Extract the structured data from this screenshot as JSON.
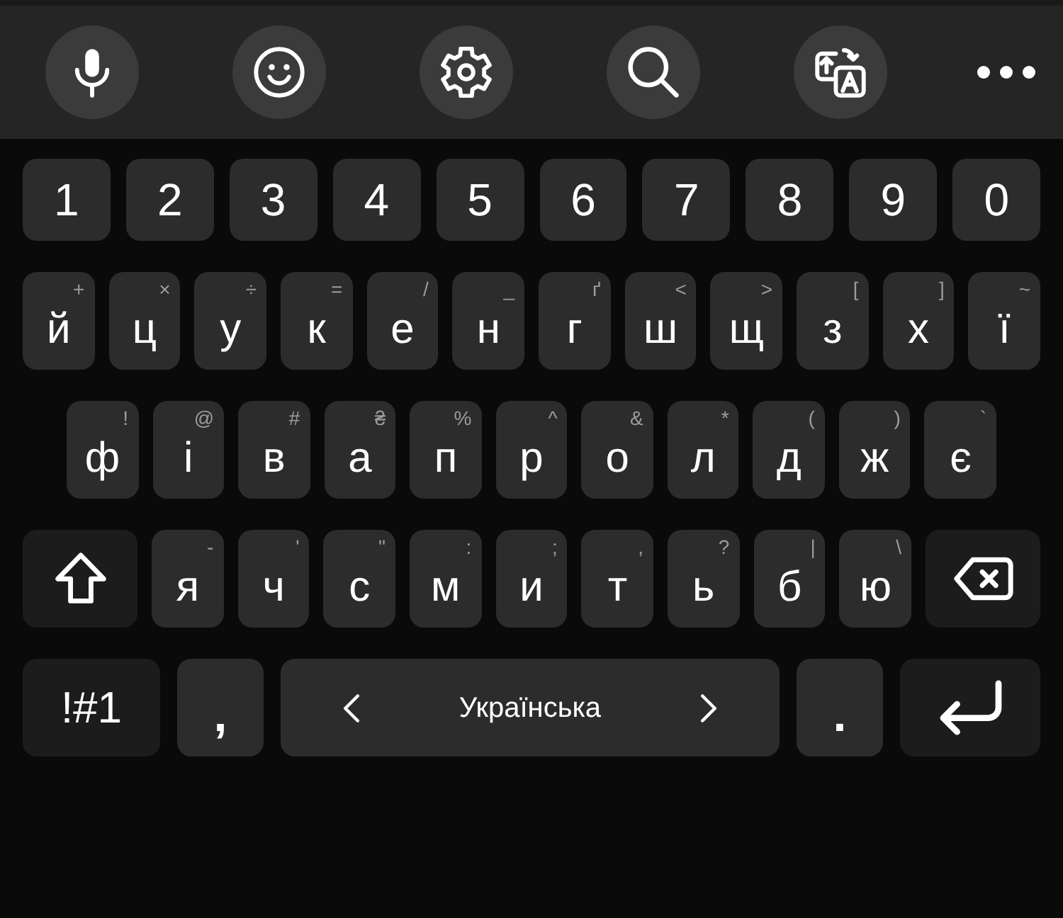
{
  "toolbar": {
    "buttons": [
      {
        "kind": "microphone"
      },
      {
        "kind": "emoji"
      },
      {
        "kind": "settings"
      },
      {
        "kind": "search"
      },
      {
        "kind": "translate"
      },
      {
        "kind": "more"
      }
    ]
  },
  "keyboard": {
    "rows": [
      {
        "keys": [
          {
            "kind": "number",
            "label": "1"
          },
          {
            "kind": "number",
            "label": "2"
          },
          {
            "kind": "number",
            "label": "3"
          },
          {
            "kind": "number",
            "label": "4"
          },
          {
            "kind": "number",
            "label": "5"
          },
          {
            "kind": "number",
            "label": "6"
          },
          {
            "kind": "number",
            "label": "7"
          },
          {
            "kind": "number",
            "label": "8"
          },
          {
            "kind": "number",
            "label": "9"
          },
          {
            "kind": "number",
            "label": "0"
          }
        ]
      },
      {
        "keys": [
          {
            "kind": "letter",
            "label": "й",
            "hint": "+"
          },
          {
            "kind": "letter",
            "label": "ц",
            "hint": "×"
          },
          {
            "kind": "letter",
            "label": "у",
            "hint": "÷"
          },
          {
            "kind": "letter",
            "label": "к",
            "hint": "="
          },
          {
            "kind": "letter",
            "label": "е",
            "hint": "/"
          },
          {
            "kind": "letter",
            "label": "н",
            "hint": "_"
          },
          {
            "kind": "letter",
            "label": "г",
            "hint": "ґ"
          },
          {
            "kind": "letter",
            "label": "ш",
            "hint": "<"
          },
          {
            "kind": "letter",
            "label": "щ",
            "hint": ">"
          },
          {
            "kind": "letter",
            "label": "з",
            "hint": "["
          },
          {
            "kind": "letter",
            "label": "х",
            "hint": "]"
          },
          {
            "kind": "letter",
            "label": "ї",
            "hint": "~"
          }
        ]
      },
      {
        "keys": [
          {
            "kind": "letter",
            "label": "ф",
            "hint": "!"
          },
          {
            "kind": "letter",
            "label": "і",
            "hint": "@"
          },
          {
            "kind": "letter",
            "label": "в",
            "hint": "#"
          },
          {
            "kind": "letter",
            "label": "а",
            "hint": "₴"
          },
          {
            "kind": "letter",
            "label": "п",
            "hint": "%"
          },
          {
            "kind": "letter",
            "label": "р",
            "hint": "^"
          },
          {
            "kind": "letter",
            "label": "о",
            "hint": "&"
          },
          {
            "kind": "letter",
            "label": "л",
            "hint": "*"
          },
          {
            "kind": "letter",
            "label": "д",
            "hint": "("
          },
          {
            "kind": "letter",
            "label": "ж",
            "hint": ")"
          },
          {
            "kind": "letter",
            "label": "є",
            "hint": "`"
          }
        ]
      },
      {
        "keys": [
          {
            "kind": "shift"
          },
          {
            "kind": "letter",
            "label": "я",
            "hint": "-"
          },
          {
            "kind": "letter",
            "label": "ч",
            "hint": "'"
          },
          {
            "kind": "letter",
            "label": "с",
            "hint": "\""
          },
          {
            "kind": "letter",
            "label": "м",
            "hint": ":"
          },
          {
            "kind": "letter",
            "label": "и",
            "hint": ";"
          },
          {
            "kind": "letter",
            "label": "т",
            "hint": ","
          },
          {
            "kind": "letter",
            "label": "ь",
            "hint": "?"
          },
          {
            "kind": "letter",
            "label": "б",
            "hint": "|"
          },
          {
            "kind": "letter",
            "label": "ю",
            "hint": "\\"
          },
          {
            "kind": "backspace"
          }
        ]
      },
      {
        "keys": [
          {
            "kind": "symbols",
            "label": "!#1"
          },
          {
            "kind": "punctuation",
            "label": ","
          },
          {
            "kind": "space",
            "label": "Українська"
          },
          {
            "kind": "punctuation",
            "label": "."
          },
          {
            "kind": "enter"
          }
        ]
      }
    ]
  }
}
